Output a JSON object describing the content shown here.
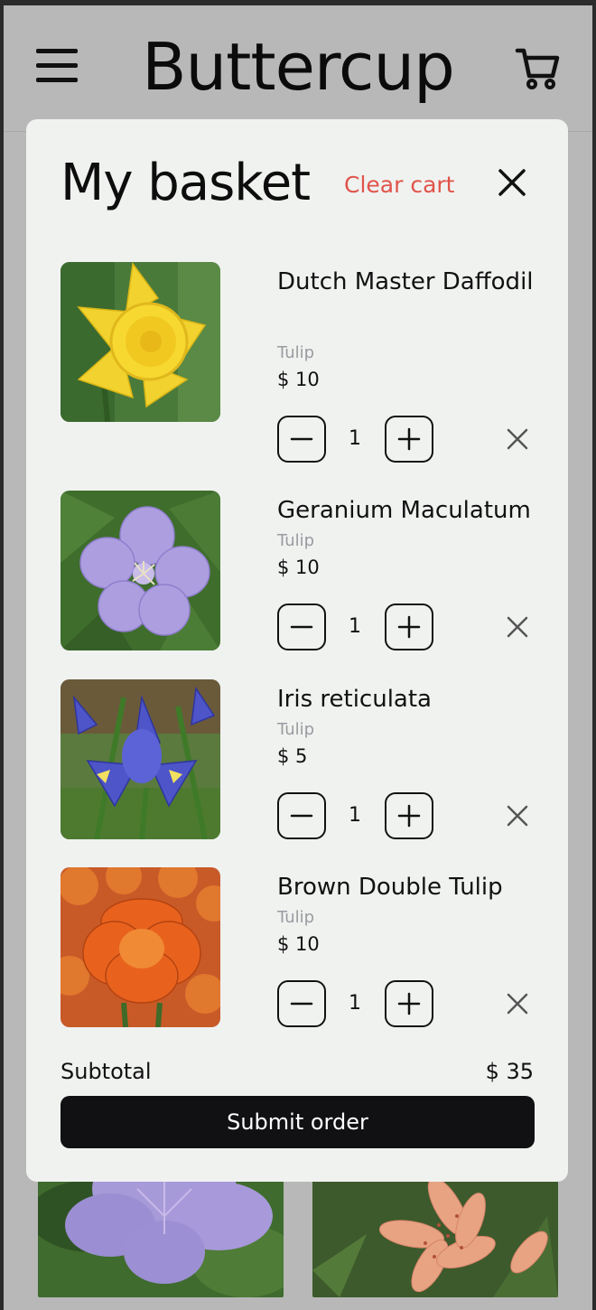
{
  "header": {
    "brand": "Buttercup",
    "menu_icon": "hamburger-icon",
    "cart_icon": "shopping-cart-icon"
  },
  "basket": {
    "title": "My basket",
    "clear_label": "Clear cart",
    "close_icon": "close-icon",
    "items": [
      {
        "name": "Dutch Master Daffodil",
        "category": "Tulip",
        "price": "$ 10",
        "quantity": "1"
      },
      {
        "name": "Geranium Maculatum",
        "category": "Tulip",
        "price": "$ 10",
        "quantity": "1"
      },
      {
        "name": "Iris reticulata",
        "category": "Tulip",
        "price": "$ 5",
        "quantity": "1"
      },
      {
        "name": "Brown Double Tulip",
        "category": "Tulip",
        "price": "$ 10",
        "quantity": "1"
      }
    ],
    "subtotal_label": "Subtotal",
    "subtotal_value": "$ 35",
    "submit_label": "Submit order"
  },
  "colors": {
    "accent_red": "#e0544a",
    "primary_button": "#111114",
    "modal_bg": "#f0f2f0",
    "backdrop": "#b8b8b8"
  }
}
